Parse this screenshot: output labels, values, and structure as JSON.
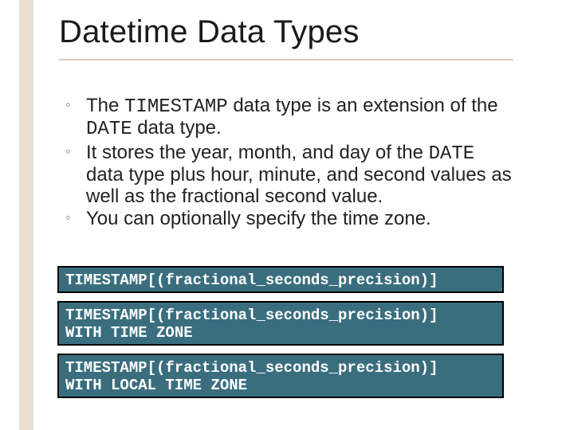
{
  "title": "Datetime Data Types",
  "bullets": [
    {
      "pre": "The ",
      "code1": "TIMESTAMP",
      "mid": " data type is an extension of the ",
      "code2": "DATE",
      "post": " data type."
    },
    {
      "pre": "It stores the year, month, and day of the ",
      "code1": "DATE",
      "mid": " data type plus hour, minute, and second values as well as the fractional second value.",
      "code2": "",
      "post": ""
    },
    {
      "pre": "You can optionally specify the time zone.",
      "code1": "",
      "mid": "",
      "code2": "",
      "post": ""
    }
  ],
  "syntax": {
    "box1": "TIMESTAMP[(fractional_seconds_precision)]",
    "box2": "TIMESTAMP[(fractional_seconds_precision)]\nWITH TIME ZONE",
    "box3": "TIMESTAMP[(fractional_seconds_precision)]\nWITH LOCAL TIME ZONE"
  }
}
